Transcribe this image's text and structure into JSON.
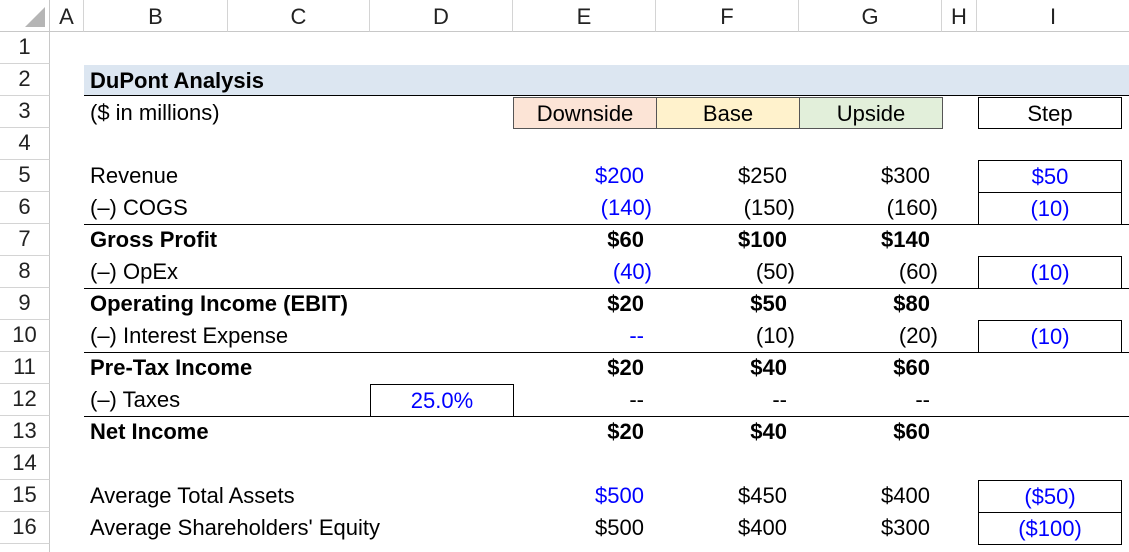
{
  "columns": [
    "A",
    "B",
    "C",
    "D",
    "E",
    "F",
    "G",
    "H",
    "I"
  ],
  "rows": [
    "1",
    "2",
    "3",
    "4",
    "5",
    "6",
    "7",
    "8",
    "9",
    "10",
    "11",
    "12",
    "13",
    "14",
    "15",
    "16"
  ],
  "title": "DuPont Analysis",
  "subtitle": "($ in millions)",
  "scenarios": {
    "downside": "Downside",
    "base": "Base",
    "upside": "Upside",
    "step": "Step"
  },
  "lines": [
    {
      "label": "Revenue",
      "down": "$200",
      "base": "$250",
      "up": "$300",
      "step": "$50"
    },
    {
      "label": "(–) COGS",
      "down": "(140)",
      "base": "(150)",
      "up": "(160)",
      "step": "(10)"
    },
    {
      "label": "Gross Profit",
      "down": "$60",
      "base": "$100",
      "up": "$140",
      "step": ""
    },
    {
      "label": "(–) OpEx",
      "down": "(40)",
      "base": "(50)",
      "up": "(60)",
      "step": "(10)"
    },
    {
      "label": "Operating Income (EBIT)",
      "down": "$20",
      "base": "$50",
      "up": "$80",
      "step": ""
    },
    {
      "label": "(–) Interest Expense",
      "down": "--",
      "base": "(10)",
      "up": "(20)",
      "step": "(10)"
    },
    {
      "label": "Pre-Tax Income",
      "down": "$20",
      "base": "$40",
      "up": "$60",
      "step": ""
    },
    {
      "label": "(–) Taxes",
      "tax_rate": "25.0%",
      "down": "--",
      "base": "--",
      "up": "--",
      "step": ""
    },
    {
      "label": "Net Income",
      "down": "$20",
      "base": "$40",
      "up": "$60",
      "step": ""
    },
    {
      "label": "Average Total Assets",
      "down": "$500",
      "base": "$450",
      "up": "$400",
      "step": "($50)"
    },
    {
      "label": "Average Shareholders' Equity",
      "down": "$500",
      "base": "$400",
      "up": "$300",
      "step": "($100)"
    }
  ],
  "colors": {
    "title_band": "#dce6f1",
    "downside_fill": "#fce4d6",
    "base_fill": "#fff2cc",
    "upside_fill": "#e2efda",
    "input_blue": "#0000ff"
  }
}
